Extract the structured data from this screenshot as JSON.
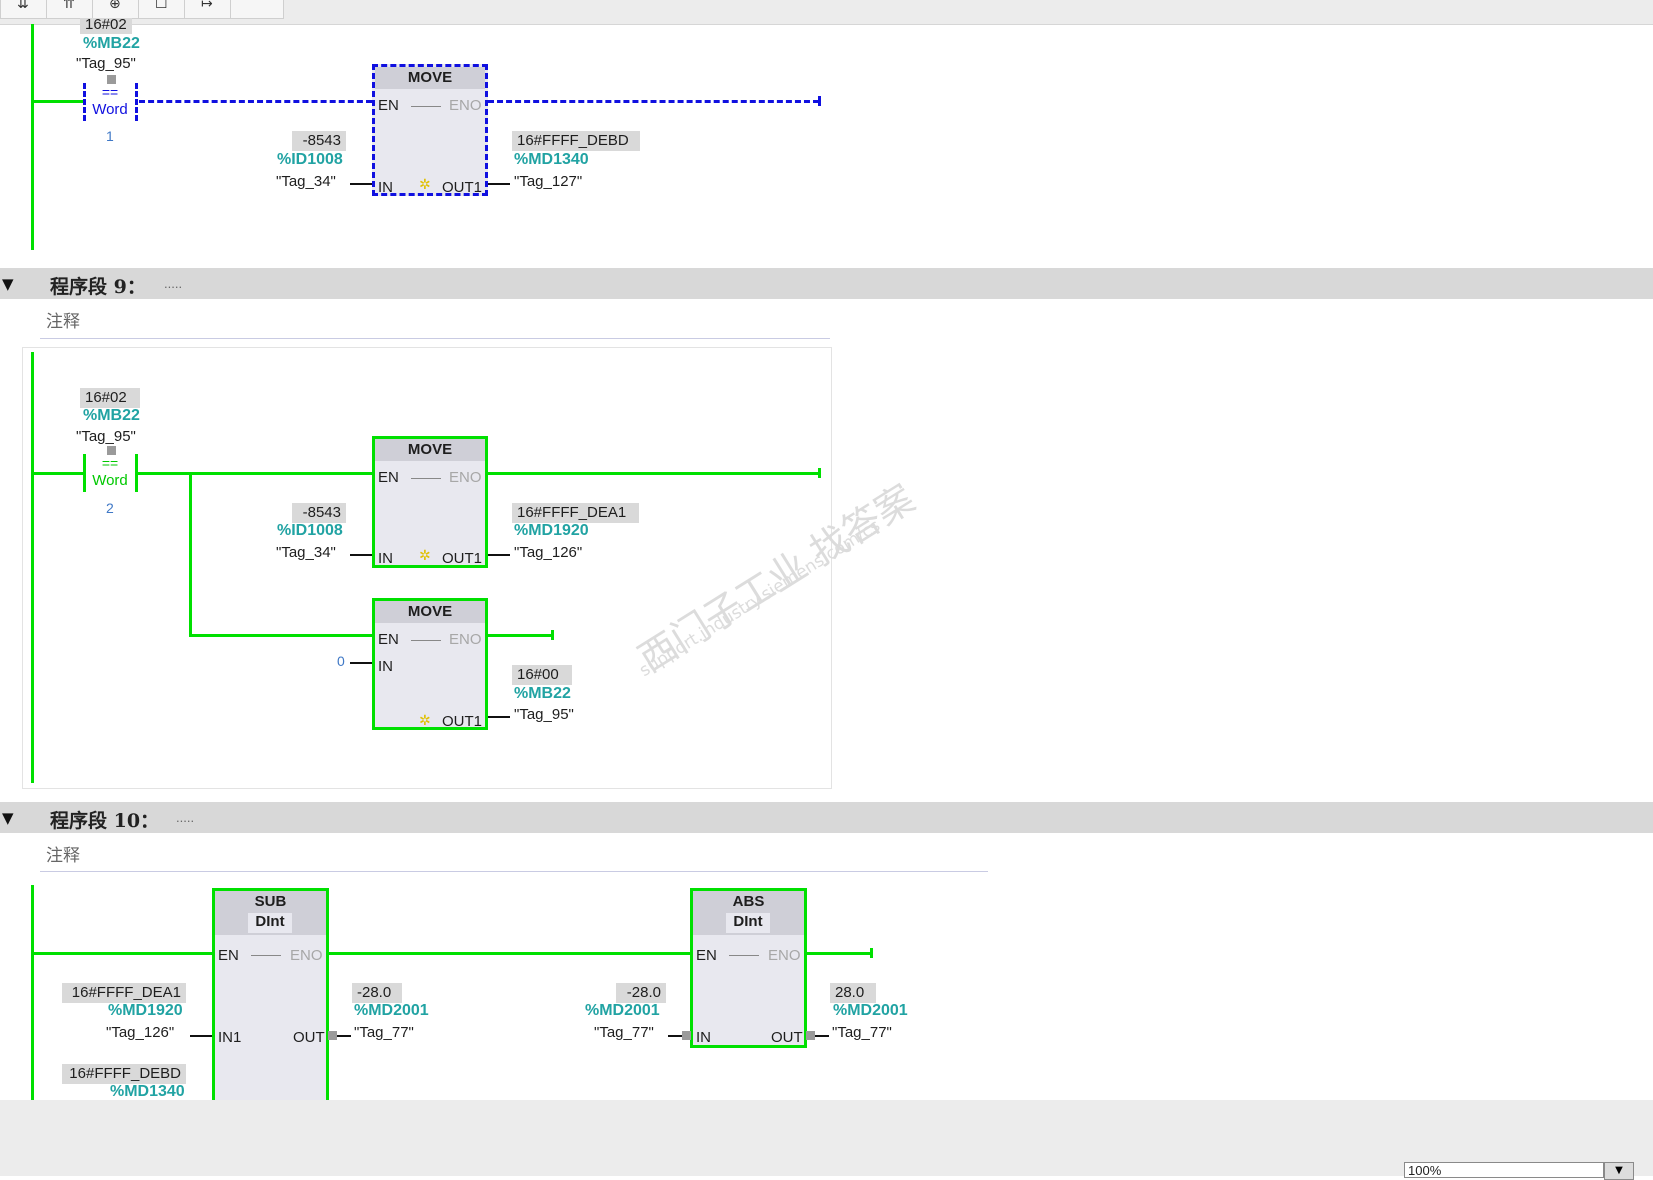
{
  "toolbar": {
    "buttons": [
      {
        "icon": "insert-network-icon",
        "glyph": "⇊"
      },
      {
        "icon": "delete-network-icon",
        "glyph": "⇈"
      },
      {
        "icon": "branch-icon",
        "glyph": "⊕"
      },
      {
        "icon": "box-icon",
        "glyph": "☐"
      },
      {
        "icon": "arrow-icon",
        "glyph": "↦"
      },
      {
        "icon": "more-icon",
        "glyph": ""
      }
    ]
  },
  "network8": {
    "contact": {
      "value": "16#02",
      "address": "%MB22",
      "tag": "\"Tag_95\"",
      "operator": "==",
      "type": "Word",
      "operand2": "1"
    },
    "move": {
      "name": "MOVE",
      "en": "EN",
      "eno": "ENO",
      "in_pin": "IN",
      "out_pin": "OUT1",
      "in_value": "-8543",
      "in_address": "%ID1008",
      "in_tag": "\"Tag_34\"",
      "out_value": "16#FFFF_DEBD",
      "out_address": "%MD1340",
      "out_tag": "\"Tag_127\""
    }
  },
  "network9": {
    "title": "程序段 9：",
    "dots": ".....",
    "comment": "注释",
    "contact": {
      "value": "16#02",
      "address": "%MB22",
      "tag": "\"Tag_95\"",
      "operator": "==",
      "type": "Word",
      "operand2": "2"
    },
    "move1": {
      "name": "MOVE",
      "en": "EN",
      "eno": "ENO",
      "in_pin": "IN",
      "out_pin": "OUT1",
      "in_value": "-8543",
      "in_address": "%ID1008",
      "in_tag": "\"Tag_34\"",
      "out_value": "16#FFFF_DEA1",
      "out_address": "%MD1920",
      "out_tag": "\"Tag_126\""
    },
    "move2": {
      "name": "MOVE",
      "en": "EN",
      "eno": "ENO",
      "in_pin": "IN",
      "out_pin": "OUT1",
      "in_const": "0",
      "out_value": "16#00",
      "out_address": "%MB22",
      "out_tag": "\"Tag_95\""
    }
  },
  "network10": {
    "title": "程序段 10：",
    "dots": ".....",
    "comment": "注释",
    "sub": {
      "name": "SUB",
      "type": "DInt",
      "en": "EN",
      "eno": "ENO",
      "in1_pin": "IN1",
      "out_pin": "OUT",
      "in1_value": "16#FFFF_DEA1",
      "in1_address": "%MD1920",
      "in1_tag": "\"Tag_126\"",
      "in2_value": "16#FFFF_DEBD",
      "in2_address": "%MD1340",
      "out_value": "-28.0",
      "out_address": "%MD2001",
      "out_tag": "\"Tag_77\""
    },
    "abs": {
      "name": "ABS",
      "type": "DInt",
      "en": "EN",
      "eno": "ENO",
      "in_pin": "IN",
      "out_pin": "OUT",
      "in_value": "-28.0",
      "in_address": "%MD2001",
      "in_tag": "\"Tag_77\"",
      "out_value": "28.0",
      "out_address": "%MD2001",
      "out_tag": "\"Tag_77\""
    }
  },
  "watermark": {
    "line1": "西门子工业  找答案",
    "line2": "support.industry.siemens.com/cs"
  },
  "status": {
    "zoom": "100%"
  },
  "colors": {
    "power_flow": "#00e000",
    "selection": "#1010e0",
    "address": "#21a3a3",
    "value_bg": "#d9d9d9",
    "block_bg": "#e8e8ef"
  }
}
